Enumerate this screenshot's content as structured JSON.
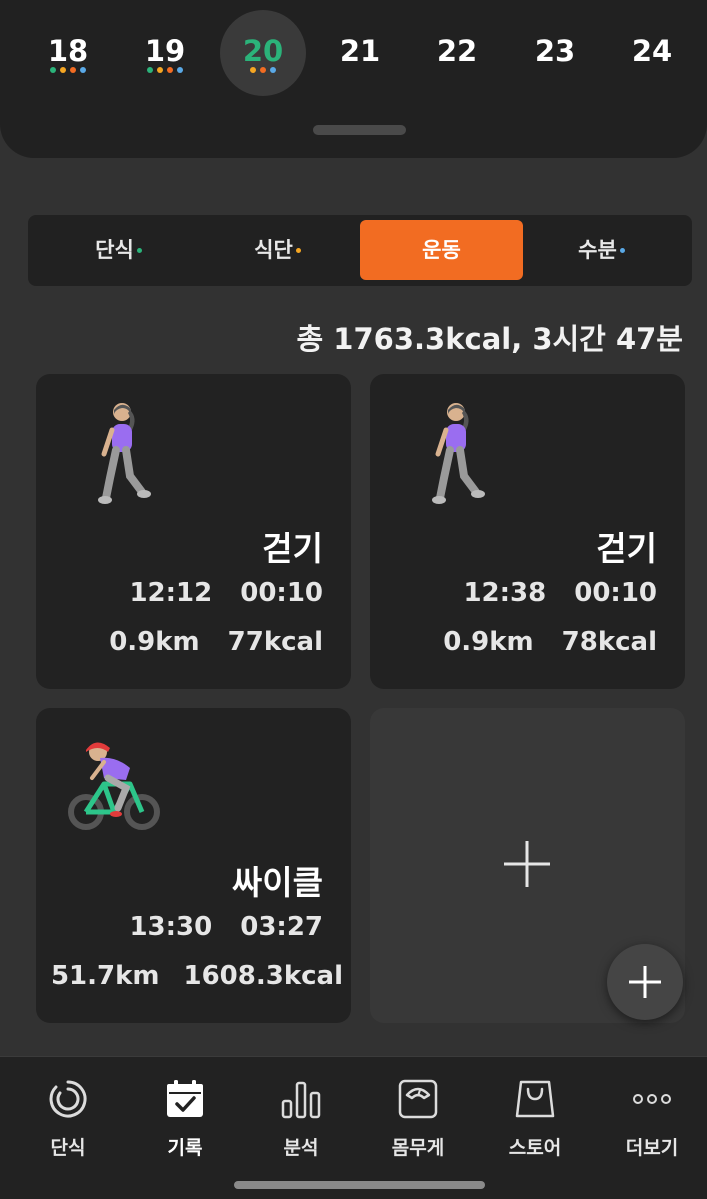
{
  "dates": [
    {
      "day": "18",
      "dots": [
        "#2bb37a",
        "#f5a623",
        "#f26c22",
        "#5aa9e6"
      ],
      "selected": false
    },
    {
      "day": "19",
      "dots": [
        "#2bb37a",
        "#f5a623",
        "#f26c22",
        "#5aa9e6"
      ],
      "selected": false
    },
    {
      "day": "20",
      "dots": [
        "#f5a623",
        "#f26c22",
        "#5aa9e6"
      ],
      "selected": true
    },
    {
      "day": "21",
      "dots": [],
      "selected": false
    },
    {
      "day": "22",
      "dots": [],
      "selected": false
    },
    {
      "day": "23",
      "dots": [],
      "selected": false
    },
    {
      "day": "24",
      "dots": [],
      "selected": false
    }
  ],
  "tabs": [
    {
      "label": "단식",
      "dot_color": "#2bb37a",
      "active": false
    },
    {
      "label": "식단",
      "dot_color": "#f5a623",
      "active": false
    },
    {
      "label": "운동",
      "dot_color": "",
      "active": true
    },
    {
      "label": "수분",
      "dot_color": "#5aa9e6",
      "active": false
    }
  ],
  "summary": "총 1763.3kcal, 3시간 47분",
  "cards": [
    {
      "emoji": "🚶‍♀️",
      "icon": "walking-woman-icon",
      "name": "걷기",
      "start": "12:12",
      "duration": "00:10",
      "distance": "0.9km",
      "calories": "77kcal"
    },
    {
      "emoji": "🚶‍♀️",
      "icon": "walking-woman-icon",
      "name": "걷기",
      "start": "12:38",
      "duration": "00:10",
      "distance": "0.9km",
      "calories": "78kcal"
    },
    {
      "emoji": "🚴‍♀️",
      "icon": "cycling-woman-icon",
      "name": "싸이클",
      "start": "13:30",
      "duration": "03:27",
      "distance": "51.7km",
      "calories": "1608.3kcal"
    }
  ],
  "add_card": {
    "icon": "plus-icon"
  },
  "fab": {
    "icon": "plus-icon"
  },
  "nav": [
    {
      "label": "단식",
      "icon": "fasting-timer-icon"
    },
    {
      "label": "기록",
      "icon": "calendar-check-icon"
    },
    {
      "label": "분석",
      "icon": "bar-chart-icon"
    },
    {
      "label": "몸무게",
      "icon": "scale-icon"
    },
    {
      "label": "스토어",
      "icon": "shopping-bag-icon"
    },
    {
      "label": "더보기",
      "icon": "more-dots-icon"
    }
  ],
  "colors": {
    "accent": "#f26c22",
    "selected_date": "#2bb37a",
    "background": "#323232",
    "panel": "#212121"
  }
}
